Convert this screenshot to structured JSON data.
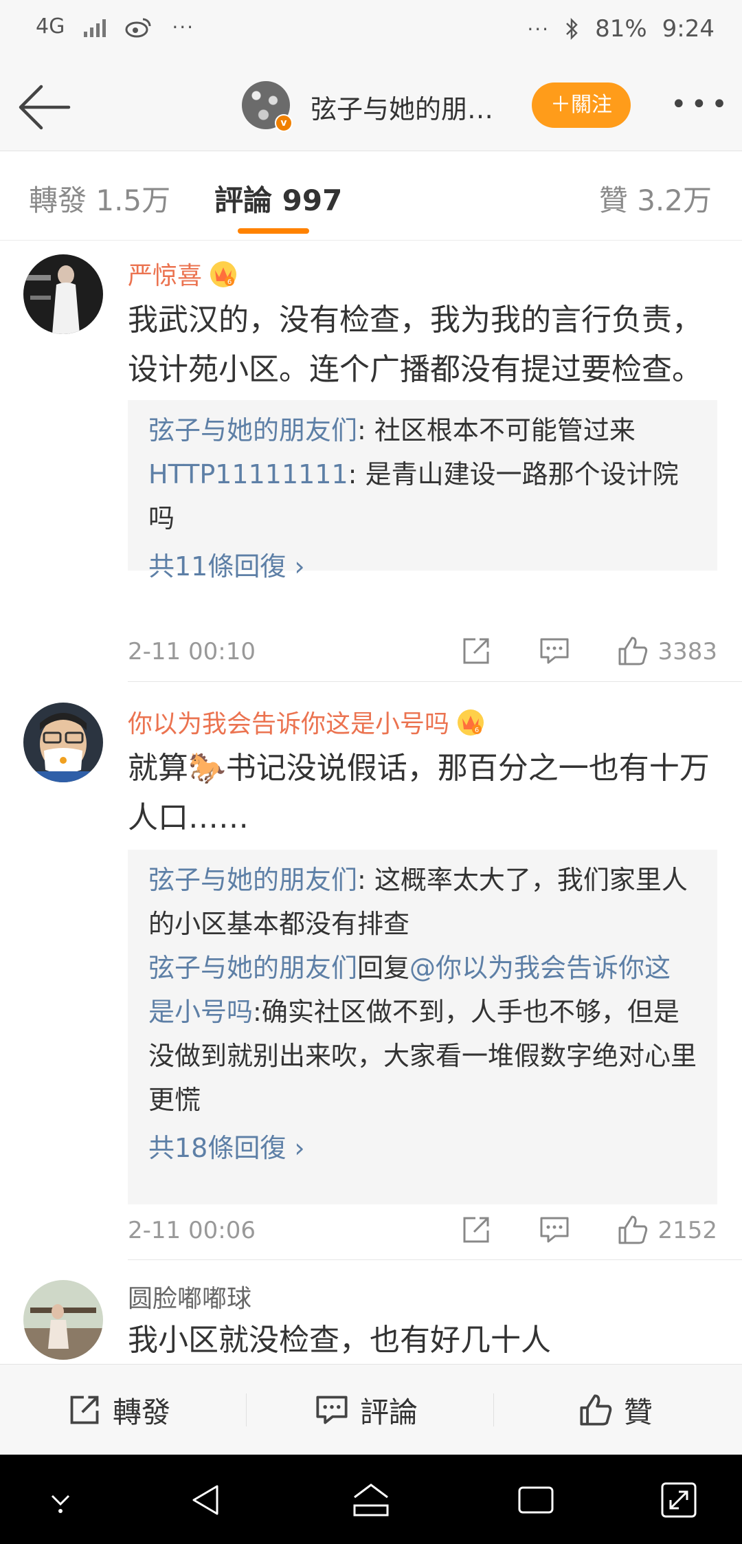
{
  "status_bar": {
    "network": "4G",
    "network_sub": "",
    "left_more": "···",
    "right_more": "···",
    "battery": "81%",
    "time": "9:24"
  },
  "nav": {
    "title": "弦子与她的朋…",
    "follow_label": "＋關注",
    "more_label": "•••"
  },
  "tabs": [
    {
      "label": "轉發 1.5万",
      "active": false
    },
    {
      "label": "評論 997",
      "active": true
    },
    {
      "label": "贊 3.2万",
      "active": false
    }
  ],
  "comments": [
    {
      "name": "严惊喜",
      "vip": true,
      "text": "我武汉的，没有检查，我为我的言行负责，设计苑小区。连个广播都没有提过要检查。",
      "replies": [
        {
          "name": "弦子与她的朋友们",
          "sep": ": ",
          "mention": "",
          "text": "社区根本不可能管过来"
        },
        {
          "name": "HTTP11111111",
          "sep": ": ",
          "mention": "",
          "text": "是青山建设一路那个设计院吗"
        }
      ],
      "more_replies": "共11條回復 ›",
      "time": "2-11 00:10",
      "likes": "3383"
    },
    {
      "name": "你以为我会告诉你这是小号吗",
      "vip": true,
      "text_before": "就算",
      "text_emoji": "🐎",
      "text_after": "书记没说假话，那百分之一也有十万人口……",
      "replies": [
        {
          "name": "弦子与她的朋友们",
          "sep": ": ",
          "mention": "",
          "text": "这概率太大了，我们家里人的小区基本都没有排查"
        },
        {
          "name": "弦子与她的朋友们",
          "sep": "回复",
          "mention": "@你以为我会告诉你这是小号吗",
          "text": ":确实社区做不到，人手也不够，但是没做到就别出来吹，大家看一堆假数字绝对心里更慌"
        }
      ],
      "more_replies": "共18條回復 ›",
      "time": "2-11 00:06",
      "likes": "2152"
    },
    {
      "name": "圆脸嘟嘟球",
      "vip": false,
      "text": "我小区就没检查，也有好几十人"
    }
  ],
  "bottom_bar": {
    "repost": "轉發",
    "comment": "評論",
    "like": "贊"
  },
  "colors": {
    "accent": "#ff8200",
    "follow_bg": "#ff9c1a",
    "vip_name": "#eb7350",
    "link": "#5d7fa6"
  }
}
